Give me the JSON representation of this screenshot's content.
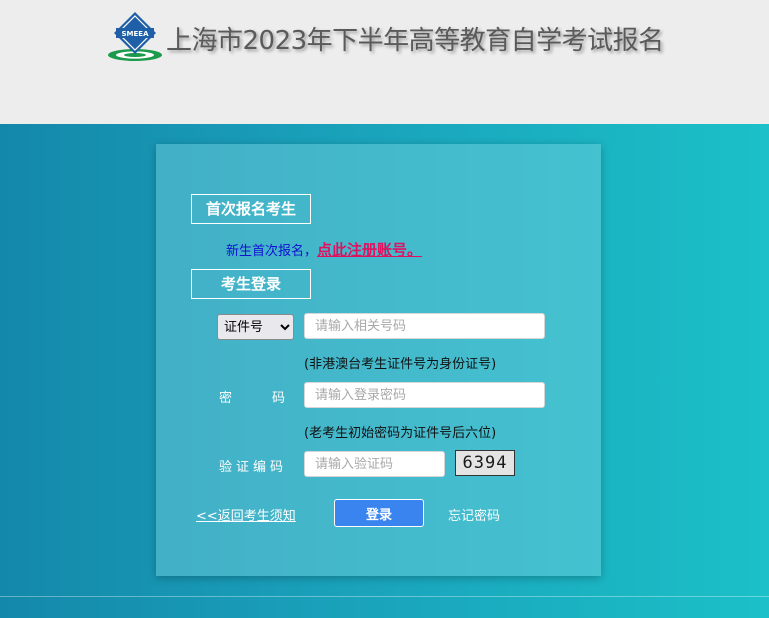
{
  "header": {
    "title": "上海市2023年下半年高等教育自学考试报名",
    "logo_text": "SMEEA"
  },
  "first_time": {
    "section_title": "首次报名考生",
    "intro_text": "新生首次报名，",
    "register_link": "点此注册账号。"
  },
  "login": {
    "section_title": "考生登录",
    "id_type": {
      "selected": "证件号",
      "options": [
        "证件号"
      ]
    },
    "id_input": {
      "placeholder": "请输入相关号码",
      "value": ""
    },
    "id_hint": "(非港澳台考生证件号为身份证号)",
    "password_label": "密码",
    "password_input": {
      "placeholder": "请输入登录密码",
      "value": ""
    },
    "password_hint": "(老考生初始密码为证件号后六位)",
    "captcha_label": "验证编码",
    "captcha_input": {
      "placeholder": "请输入验证码",
      "value": ""
    },
    "captcha_text": "6394",
    "back_link": "<<返回考生须知",
    "login_button": "登录",
    "forgot_link": "忘记密码"
  },
  "colors": {
    "background_left": "#1488aa",
    "background_right": "#1bc0c8",
    "login_button": "#3a84f0",
    "register_link": "#e0115f",
    "intro_text": "#1010d0"
  }
}
